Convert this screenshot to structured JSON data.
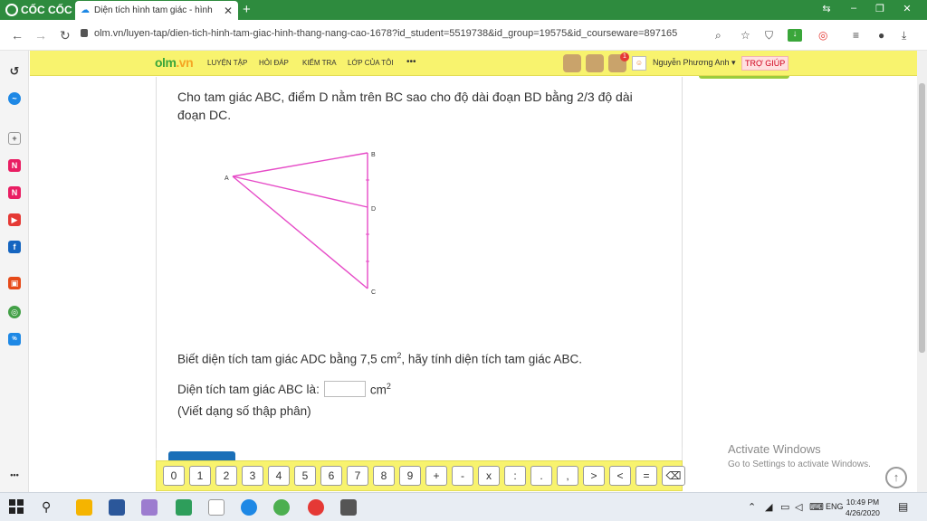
{
  "browser": {
    "brand": "CỐC CỐC",
    "tab_title": "Diện tích hình tam giác - hình",
    "tab_close": "✕",
    "new_tab": "+",
    "url": "olm.vn/luyen-tap/dien-tich-hinh-tam-giac-hinh-thang-nang-cao-1678?id_student=5519738&id_group=19575&id_courseware=897165",
    "back": "←",
    "forward": "→",
    "reload": "↻"
  },
  "site": {
    "logo_main": "olm",
    "logo_tld": ".vn",
    "nav": [
      "LUYỆN TẬP",
      "HỎI ĐÁP",
      "KIỂM TRA",
      "LỚP CỦA TÔI",
      "•••"
    ],
    "notification_count": "1",
    "username": "Nguyễn Phương Anh ▾",
    "help": "TRỢ GIÚP"
  },
  "question": {
    "intro": "Cho tam giác ABC, điểm D nằm trên BC sao cho độ dài đoạn BD bằng 2/3 độ dài đoạn DC.",
    "given_pre": "Biết diện tích tam giác ADC bằng 7,5 cm",
    "given_sup": "2",
    "given_post": ", hãy tính diện tích tam giác ABC.",
    "answer_label": "Diện tích tam giác ABC là:",
    "unit": "cm",
    "unit_sup": "2",
    "hint": "(Viết dạng số thập phân)"
  },
  "figure": {
    "labels": {
      "A": "A",
      "B": "B",
      "C": "C",
      "D": "D"
    },
    "stroke_color": "#e64bc7"
  },
  "keypad": {
    "keys": [
      "0",
      "1",
      "2",
      "3",
      "4",
      "5",
      "6",
      "7",
      "8",
      "9",
      "+",
      "-",
      "x",
      ":",
      ".",
      ",",
      ">",
      "<",
      "=",
      "⌫"
    ]
  },
  "watermark": {
    "line1": "Activate Windows",
    "line2": "Go to Settings to activate Windows."
  },
  "taskbar": {
    "lang": "ENG",
    "time": "10:49 PM",
    "date": "4/26/2020"
  }
}
